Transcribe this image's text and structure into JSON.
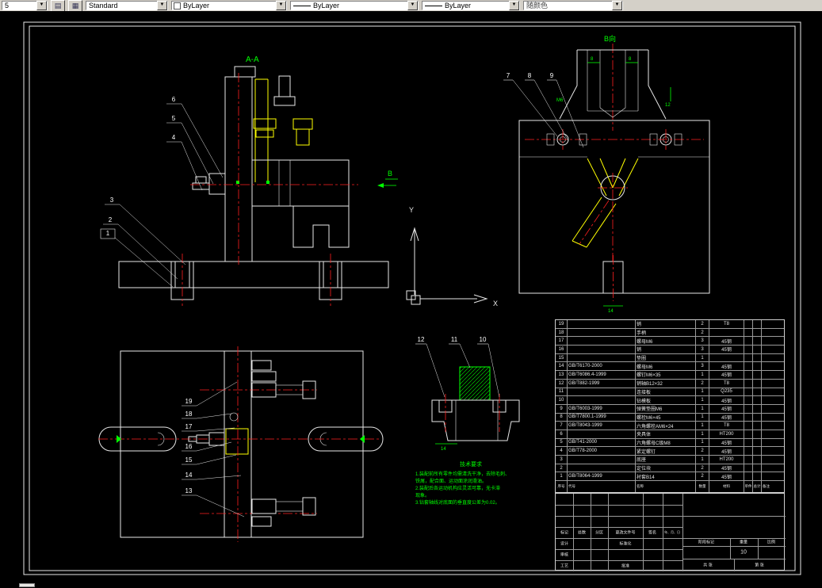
{
  "toolbar": {
    "layer_value": "5",
    "style_value": "Standard",
    "color_value": "ByLayer",
    "linetype_value": "ByLayer",
    "lineweight_value": "ByLayer",
    "plotstyle_value": "随颜色"
  },
  "drawing": {
    "section_aa": "A-A",
    "view_b": "B向",
    "section_b_mark": "B",
    "axis_x": "X",
    "axis_y": "Y"
  },
  "callouts": {
    "aa": [
      "1",
      "2",
      "3",
      "4",
      "5",
      "6"
    ],
    "b": [
      "7",
      "8",
      "9"
    ],
    "detail": [
      "10",
      "11",
      "12"
    ],
    "plan": [
      "13",
      "14",
      "15",
      "16",
      "17",
      "18",
      "19"
    ]
  },
  "dims": {
    "b_dim1": "8",
    "b_dim2": "8",
    "b_dim3": "M6",
    "b_dim4": "12",
    "b_dim5": "14",
    "detail_dim": "14"
  },
  "notes": {
    "title": "技术要求",
    "lines": [
      "1.装配前所有零件均需清洗干净，去除毛刺、",
      "铁屑，配合面、运动面涂润滑油。",
      "2.装配后各运动机构应灵活可靠，无卡滞",
      "现象。",
      "3.钻套轴线对底面的垂直度公差为0.02。"
    ]
  },
  "bom": {
    "headers": [
      "序号",
      "代号",
      "名称",
      "数量",
      "材料",
      "单件",
      "总计",
      "备注"
    ],
    "rows": [
      [
        "19",
        "",
        "销",
        "2",
        "T8",
        "",
        "",
        ""
      ],
      [
        "18",
        "",
        "手柄",
        "2",
        "",
        "",
        "",
        ""
      ],
      [
        "17",
        "",
        "螺母M6",
        "3",
        "45钢",
        "",
        "",
        ""
      ],
      [
        "16",
        "",
        "销",
        "3",
        "45钢",
        "",
        "",
        ""
      ],
      [
        "15",
        "",
        "垫圈",
        "1",
        "",
        "",
        "",
        ""
      ],
      [
        "14",
        "GB/T6170-2000",
        "螺母M6",
        "3",
        "45钢",
        "",
        "",
        ""
      ],
      [
        "13",
        "GB/T6086.4-1999",
        "螺钉M6×35",
        "1",
        "45钢",
        "",
        "",
        ""
      ],
      [
        "12",
        "GB/T882-1999",
        "销轴B12×32",
        "2",
        "T8",
        "",
        "",
        ""
      ],
      [
        "11",
        "",
        "连接板",
        "1",
        "Q235",
        "",
        "",
        ""
      ],
      [
        "10",
        "",
        "钻模板",
        "1",
        "45钢",
        "",
        "",
        ""
      ],
      [
        "9",
        "GB/T6003-1999",
        "弹簧垫圈M6",
        "1",
        "45钢",
        "",
        "",
        ""
      ],
      [
        "8",
        "GB/T7800.1-1999",
        "螺栓M6×45",
        "1",
        "45钢",
        "",
        "",
        ""
      ],
      [
        "7",
        "GB/T8043-1999",
        "六角螺栓AM6×24",
        "1",
        "T8",
        "",
        "",
        ""
      ],
      [
        "6",
        "",
        "夹具体",
        "1",
        "HT200",
        "",
        "",
        ""
      ],
      [
        "5",
        "GB/T41-2000",
        "六角螺母C级M8",
        "1",
        "45钢",
        "",
        "",
        ""
      ],
      [
        "4",
        "GB/T78-2000",
        "紧定螺钉",
        "2",
        "45钢",
        "",
        "",
        ""
      ],
      [
        "3",
        "",
        "底座",
        "1",
        "HT200",
        "",
        "",
        ""
      ],
      [
        "2",
        "",
        "定位块",
        "2",
        "45钢",
        "",
        "",
        ""
      ],
      [
        "1",
        "GB/T8064-1999",
        "衬套B14",
        "2",
        "45钢",
        "",
        "",
        ""
      ]
    ]
  },
  "titleblock": {
    "mark": "标记",
    "count": "处数",
    "zone": "分区",
    "change_doc": "更改文件号",
    "sign": "签名",
    "date": "年、月、日",
    "design": "设计",
    "check": "审核",
    "process": "工艺",
    "standardize": "标准化",
    "approve": "批准",
    "stage": "阶段标记",
    "weight": "重量",
    "scale": "比例",
    "weight_value": "10",
    "sheets_total": "共 张",
    "sheet_no": "第 张"
  }
}
